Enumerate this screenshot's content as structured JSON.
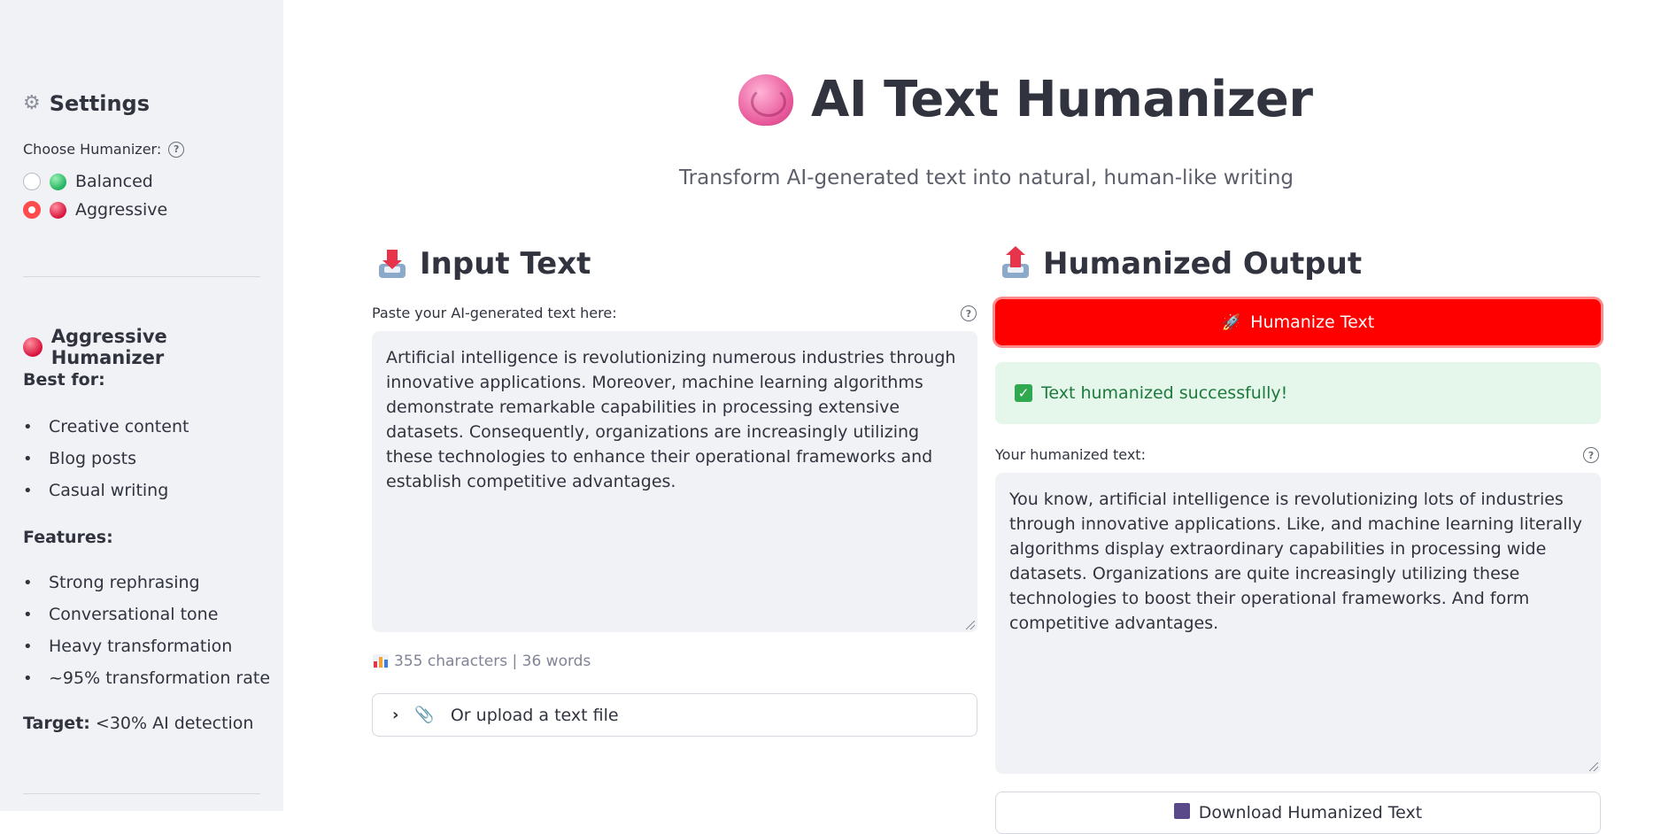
{
  "sidebar": {
    "title": "Settings",
    "humanizer_label": "Choose Humanizer:",
    "options": [
      {
        "label": "Balanced",
        "selected": false,
        "color": "#22b35e"
      },
      {
        "label": "Aggressive",
        "selected": true,
        "color": "#d8133c"
      }
    ],
    "section_title": "Aggressive Humanizer",
    "best_for_label": "Best for:",
    "best_for": [
      "Creative content",
      "Blog posts",
      "Casual writing"
    ],
    "features_label": "Features:",
    "features": [
      "Strong rephrasing",
      "Conversational tone",
      "Heavy transformation",
      "~95% transformation rate"
    ],
    "target_label": "Target:",
    "target_value": " <30% AI detection"
  },
  "header": {
    "title": "AI Text Humanizer",
    "subtitle": "Transform AI-generated text into natural, human-like writing"
  },
  "input": {
    "heading": "Input Text",
    "label": "Paste your AI-generated text here:",
    "value": "Artificial intelligence is revolutionizing numerous industries through innovative applications. Moreover, machine learning algorithms demonstrate remarkable capabilities in processing extensive datasets. Consequently, organizations are increasingly utilizing these technologies to enhance their operational frameworks and establish competitive advantages.",
    "stats": "355 characters | 36 words",
    "upload_label": "Or upload a text file"
  },
  "output": {
    "heading": "Humanized Output",
    "button_label": "Humanize Text",
    "success_message": "Text humanized successfully!",
    "label": "Your humanized text:",
    "value": "You know, artificial intelligence is revolutionizing lots of industries through innovative applications. Like, and machine learning literally algorithms display extraordinary capabilities in processing wide datasets. Organizations are quite increasingly utilizing these technologies to boost their operational frameworks. And form competitive advantages.",
    "download_label": "Download Humanized Text"
  },
  "colors": {
    "accent": "#ff4b4b",
    "primary_button": "#ff0000",
    "success_bg": "#e5f6ea",
    "success_text": "#1c7a3c",
    "sidebar_bg": "#f0f2f6"
  },
  "icons": {
    "settings": "gear-icon",
    "title": "brain-icon",
    "input": "inbox-tray-icon",
    "output": "outbox-tray-icon",
    "button": "rocket-icon",
    "success": "check-icon",
    "stats": "bar-chart-icon",
    "upload": "paperclip-icon",
    "download": "floppy-disk-icon"
  }
}
